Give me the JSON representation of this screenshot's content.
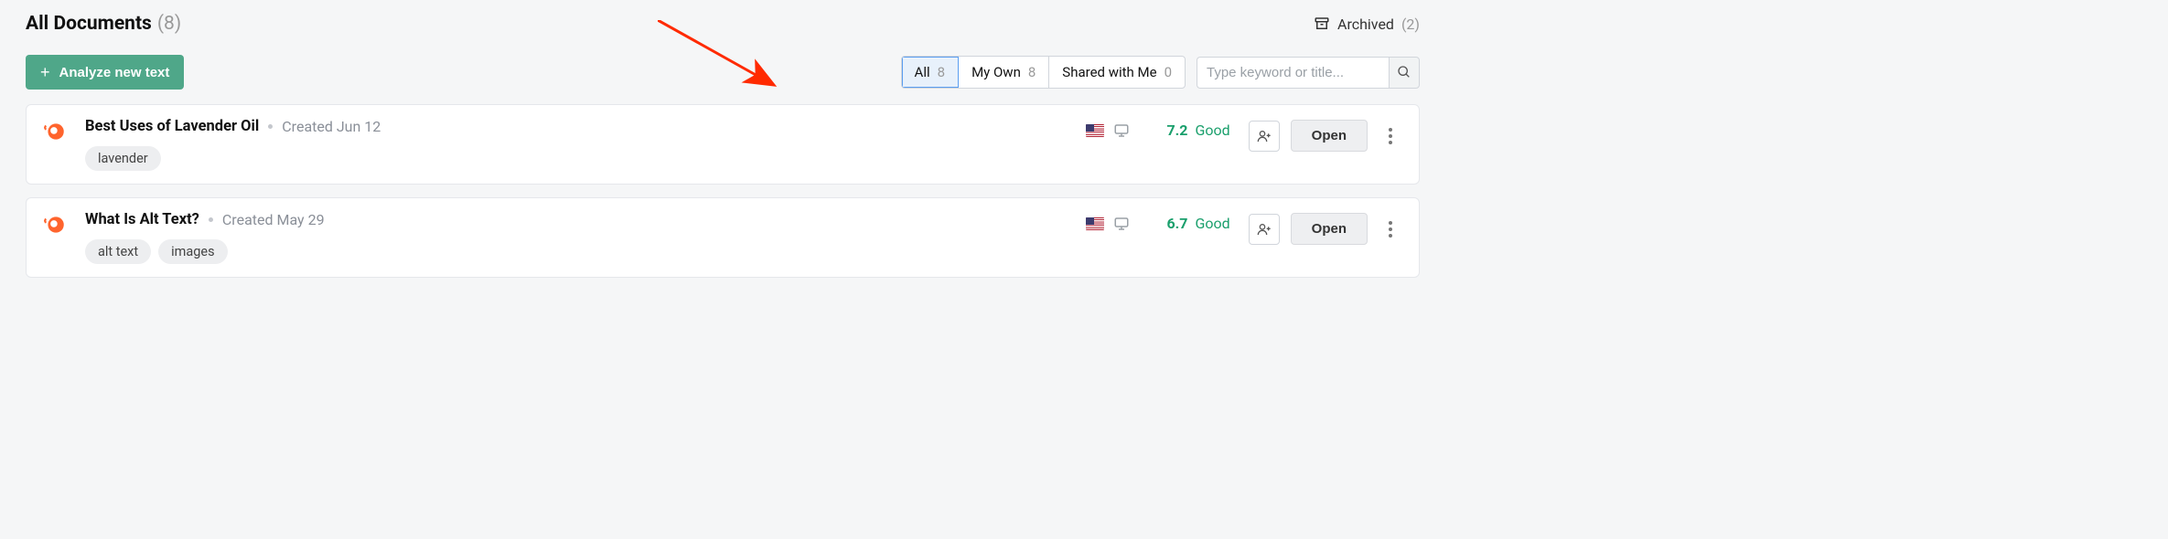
{
  "header": {
    "title": "All Documents",
    "count": "(8)"
  },
  "archived": {
    "label": "Archived",
    "count": "(2)"
  },
  "analyze_button": "Analyze new text",
  "filters": {
    "all": {
      "label": "All",
      "count": "8"
    },
    "my_own": {
      "label": "My Own",
      "count": "8"
    },
    "shared": {
      "label": "Shared with Me",
      "count": "0"
    }
  },
  "search": {
    "placeholder": "Type keyword or title..."
  },
  "documents": [
    {
      "title": "Best Uses of Lavender Oil",
      "created": "Created Jun 12",
      "tags": [
        "lavender"
      ],
      "score": "7.2",
      "score_label": "Good",
      "open": "Open"
    },
    {
      "title": "What Is Alt Text?",
      "created": "Created May 29",
      "tags": [
        "alt text",
        "images"
      ],
      "score": "6.7",
      "score_label": "Good",
      "open": "Open"
    }
  ]
}
